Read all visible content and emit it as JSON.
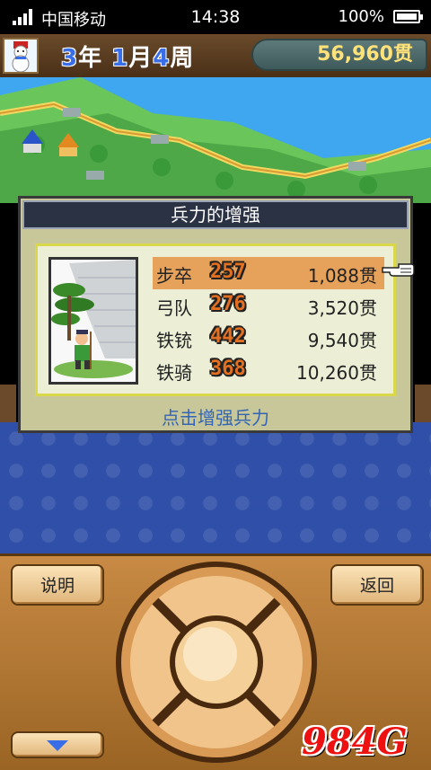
{
  "status_bar": {
    "carrier": "中国移动",
    "time": "14:38",
    "battery": "100%"
  },
  "header": {
    "year": "3",
    "year_unit": "年",
    "month": "1",
    "month_unit": "月",
    "week": "4",
    "week_unit": "周",
    "money": "56,960贯"
  },
  "dialog": {
    "title": "兵力的增强",
    "hint": "点击增强兵力",
    "units": [
      {
        "name": "步卒",
        "level": "257",
        "cost": "1,088贯",
        "selected": true
      },
      {
        "name": "弓队",
        "level": "276",
        "cost": "3,520贯",
        "selected": false
      },
      {
        "name": "铁铳",
        "level": "442",
        "cost": "9,540贯",
        "selected": false
      },
      {
        "name": "铁骑",
        "level": "368",
        "cost": "10,260贯",
        "selected": false
      }
    ]
  },
  "controls": {
    "help_label": "说明",
    "back_label": "返回"
  },
  "watermark": "984G",
  "colors": {
    "accent_blue": "#3a6ee8",
    "money_text": "#ffe27a",
    "selected_row": "#e6a15a",
    "level_digits": "#e27020",
    "hint_text": "#3465b5"
  }
}
